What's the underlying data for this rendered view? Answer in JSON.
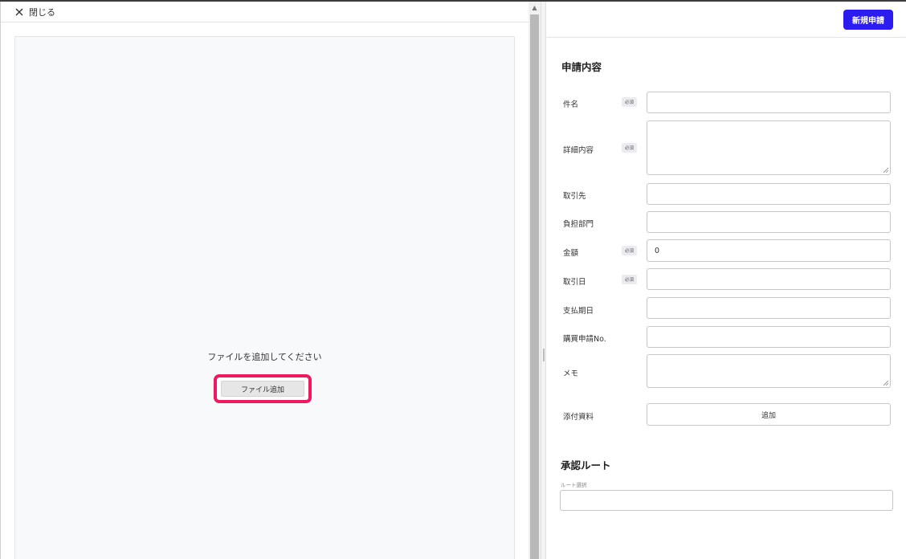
{
  "viewer": {
    "close_label": "閉じる",
    "file_hint": "ファイルを追加してください",
    "file_add_label": "ファイル追加"
  },
  "header": {
    "new_request_label": "新規申請"
  },
  "form": {
    "section_title": "申請内容",
    "required_badge": "必須",
    "fields": [
      {
        "label": "件名",
        "required": true,
        "value": ""
      },
      {
        "label": "詳細内容",
        "required": true,
        "value": ""
      },
      {
        "label": "取引先",
        "required": false,
        "value": ""
      },
      {
        "label": "負担部門",
        "required": false,
        "value": ""
      },
      {
        "label": "金額",
        "required": true,
        "value": "0"
      },
      {
        "label": "取引日",
        "required": true,
        "value": ""
      },
      {
        "label": "支払期日",
        "required": false,
        "value": ""
      },
      {
        "label": "購買申請No.",
        "required": false,
        "value": ""
      },
      {
        "label": "メモ",
        "required": false,
        "value": ""
      }
    ],
    "attachment": {
      "label": "添付資料",
      "button_label": "追加"
    }
  },
  "approval": {
    "section_title": "承認ルート",
    "route_label": "ルート選択",
    "route_value": ""
  },
  "colors": {
    "primary": "#2b1cf0",
    "highlight": "#f0185e"
  }
}
